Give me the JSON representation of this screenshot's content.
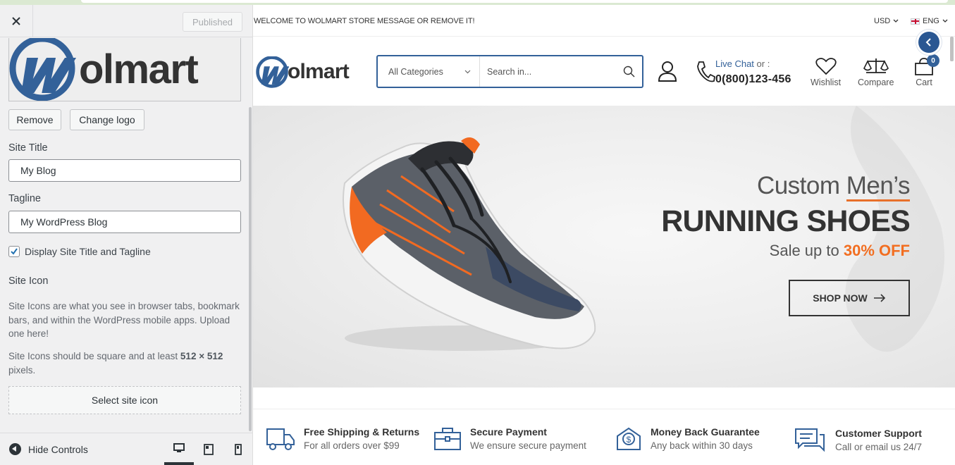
{
  "sidebar": {
    "published_label": "Published",
    "logo_text": "olmart",
    "remove_label": "Remove",
    "change_logo_label": "Change logo",
    "site_title_label": "Site Title",
    "site_title_value": "My Blog",
    "tagline_label": "Tagline",
    "tagline_value": "My WordPress Blog",
    "display_title_label": "Display Site Title and Tagline",
    "display_title_checked": true,
    "site_icon_label": "Site Icon",
    "site_icon_desc1": "Site Icons are what you see in browser tabs, bookmark bars, and within the WordPress mobile apps. Upload one here!",
    "site_icon_desc2_prefix": "Site Icons should be square and at least ",
    "site_icon_desc2_size": "512 × 512",
    "site_icon_desc2_suffix": " pixels.",
    "select_icon_label": "Select site icon",
    "hide_controls_label": "Hide Controls"
  },
  "store": {
    "welcome": "WELCOME TO WOLMART STORE MESSAGE OR REMOVE IT!",
    "currency": "USD",
    "language": "ENG",
    "logo_text": "olmart",
    "category_select": "All Categories",
    "search_placeholder": "Search in...",
    "live_chat": "Live Chat",
    "or_label": "or :",
    "phone": "0(800)123-456",
    "wishlist": "Wishlist",
    "compare": "Compare",
    "cart": "Cart",
    "cart_count": "0",
    "accent_color": "#336199"
  },
  "banner": {
    "custom": "Custom",
    "mens": "Men’s",
    "headline": "RUNNING SHOES",
    "sale_prefix": "Sale up to",
    "sale_value": "30% OFF",
    "cta": "SHOP NOW"
  },
  "features": [
    {
      "title": "Free Shipping & Returns",
      "sub": "For all orders over $99",
      "icon": "truck-icon"
    },
    {
      "title": "Secure Payment",
      "sub": "We ensure secure payment",
      "icon": "briefcase-icon"
    },
    {
      "title": "Money Back Guarantee",
      "sub": "Any back within 30 days",
      "icon": "money-back-icon"
    },
    {
      "title": "Customer Support",
      "sub": "Call or email us 24/7",
      "icon": "chat-support-icon"
    }
  ]
}
